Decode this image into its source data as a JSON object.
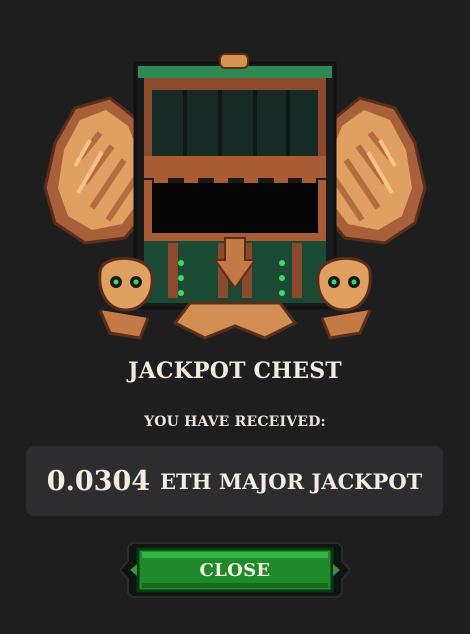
{
  "dialog": {
    "title": "JACKPOT CHEST",
    "subtitle": "YOU HAVE RECEIVED:",
    "reward": {
      "amount": "0.0304",
      "label": "ETH MAJOR JACKPOT"
    },
    "close_label": "CLOSE"
  },
  "colors": {
    "background": "#1e1e1f",
    "panel": "#2d2d30",
    "button_green": "#1f8a2a",
    "chest_green": "#1d5a3c",
    "gold": "#e0a062"
  },
  "icons": {
    "chest": "winged-jackpot-chest-icon"
  }
}
